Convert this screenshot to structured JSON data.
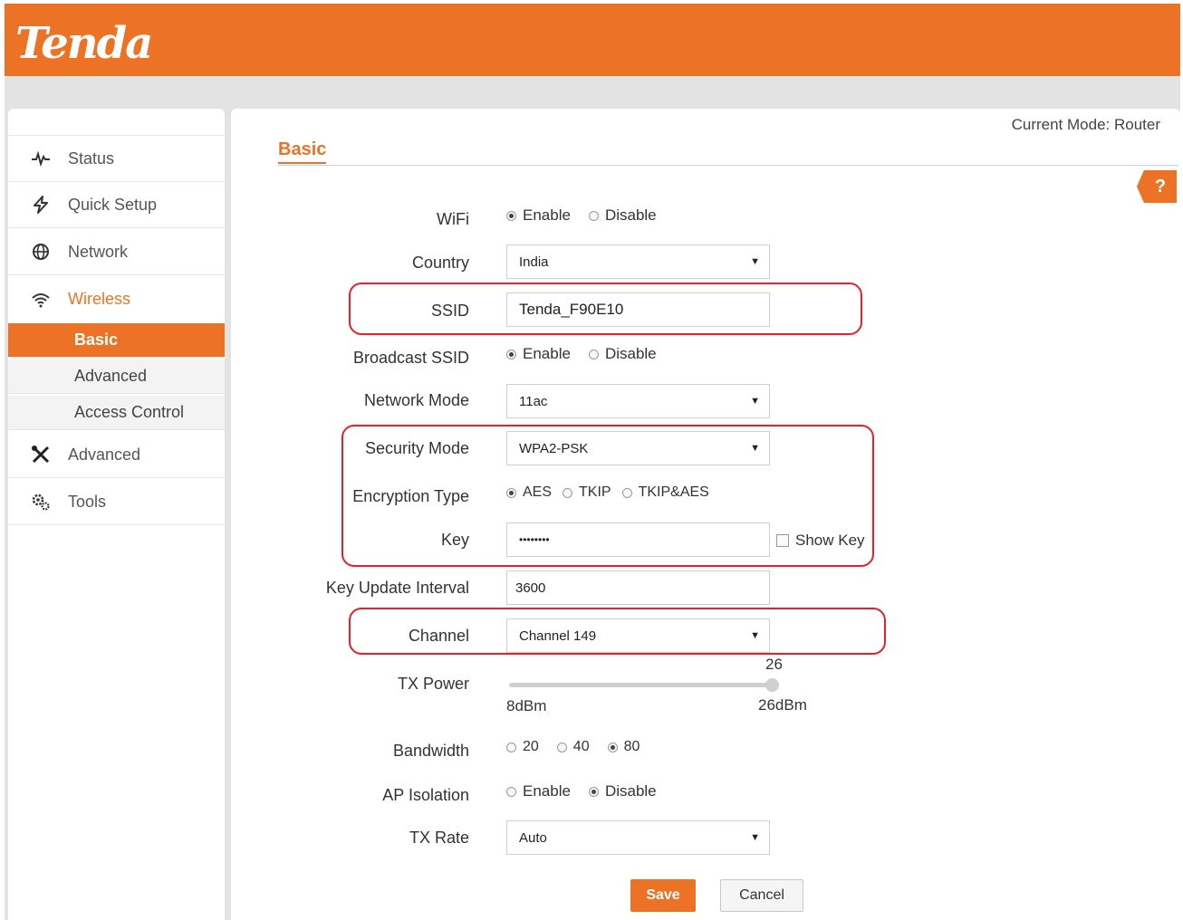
{
  "brand": {
    "logo": "Tenda",
    "accent": "#ec7325",
    "highlight": "#e8202a"
  },
  "header": {
    "mode_text": "Current Mode: Router"
  },
  "sidebar": {
    "items": [
      {
        "label": "Status",
        "icon": "pulse-icon"
      },
      {
        "label": "Quick Setup",
        "icon": "lightning-icon"
      },
      {
        "label": "Network",
        "icon": "globe-icon"
      },
      {
        "label": "Wireless",
        "icon": "wifi-icon"
      },
      {
        "label": "Advanced",
        "icon": "tools-icon"
      },
      {
        "label": "Tools",
        "icon": "gears-icon"
      }
    ],
    "wireless_sub": [
      "Basic",
      "Advanced",
      "Access Control"
    ]
  },
  "page": {
    "title": "Basic",
    "help": "?"
  },
  "form": {
    "wifi": {
      "label": "WiFi",
      "options": [
        "Enable",
        "Disable"
      ],
      "selected": "Enable"
    },
    "country": {
      "label": "Country",
      "value": "India"
    },
    "ssid": {
      "label": "SSID",
      "value": "Tenda_F90E10"
    },
    "broadcast": {
      "label": "Broadcast SSID",
      "options": [
        "Enable",
        "Disable"
      ],
      "selected": "Enable"
    },
    "network_mode": {
      "label": "Network Mode",
      "value": "11ac"
    },
    "security_mode": {
      "label": "Security Mode",
      "value": "WPA2-PSK"
    },
    "encryption": {
      "label": "Encryption Type",
      "options": [
        "AES",
        "TKIP",
        "TKIP&AES"
      ],
      "selected": "AES"
    },
    "key": {
      "label": "Key",
      "value": "••••••••",
      "show_key_label": "Show Key"
    },
    "key_interval": {
      "label": "Key Update Interval",
      "value": "3600"
    },
    "channel": {
      "label": "Channel",
      "value": "Channel 149"
    },
    "tx_power": {
      "label": "TX Power",
      "value": "26",
      "min_label": "8dBm",
      "max_label": "26dBm",
      "min": 8,
      "max": 26
    },
    "bandwidth": {
      "label": "Bandwidth",
      "options": [
        "20",
        "40",
        "80"
      ],
      "selected": "80"
    },
    "ap_isolation": {
      "label": "AP Isolation",
      "options": [
        "Enable",
        "Disable"
      ],
      "selected": "Disable"
    },
    "tx_rate": {
      "label": "TX Rate",
      "value": "Auto"
    }
  },
  "buttons": {
    "save": "Save",
    "cancel": "Cancel"
  }
}
